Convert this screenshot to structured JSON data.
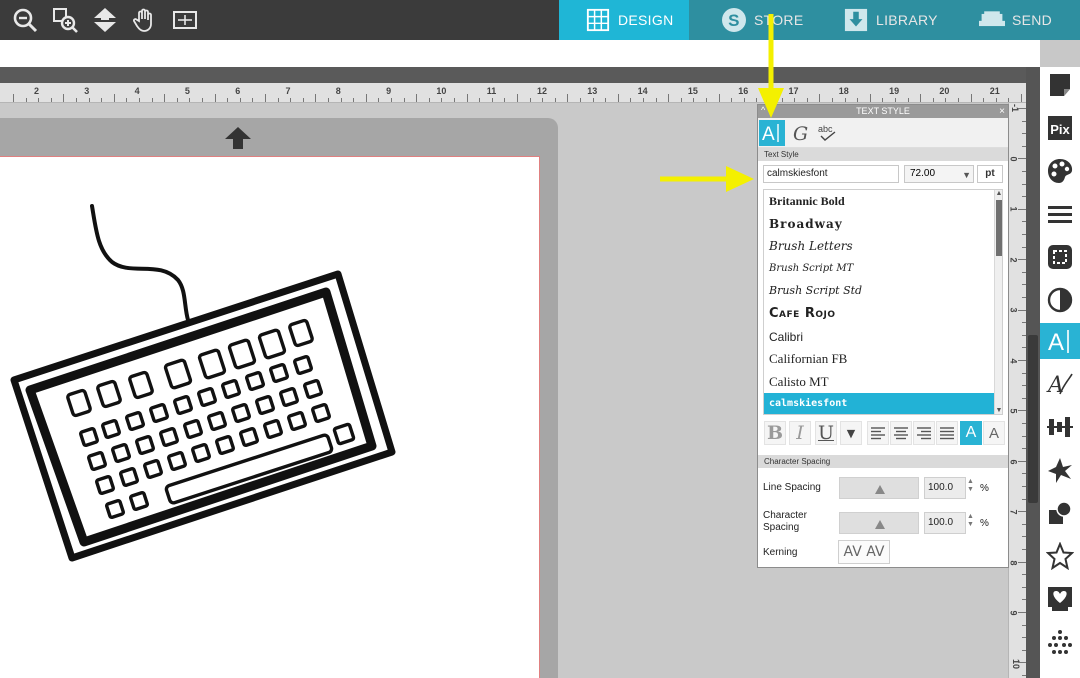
{
  "tabs": {
    "design": "DESIGN",
    "store": "STORE",
    "library": "LIBRARY",
    "send": "SEND"
  },
  "toolbar_icons": [
    "zoom-out-icon",
    "zoom-fit-icon",
    "move-icon",
    "pan-hand-icon",
    "fit-to-page-icon"
  ],
  "ruler": {
    "top_numbers": [
      "2",
      "3",
      "4",
      "5",
      "6",
      "7",
      "8",
      "9",
      "10",
      "11",
      "12",
      "13",
      "14",
      "15",
      "16",
      "17",
      "18",
      "19",
      "20",
      "21"
    ],
    "side_numbers": [
      "-1",
      "0",
      "1",
      "2",
      "3",
      "4",
      "5",
      "6",
      "7",
      "8",
      "9",
      "10"
    ]
  },
  "panel": {
    "title": "TEXT STYLE",
    "close_label": "×",
    "collapse_label": "^",
    "section_text_style": "Text Style",
    "font_name": "calmskiesfont",
    "font_size": "72.00",
    "font_unit": "pt",
    "fonts": [
      {
        "name": "Britannic Bold",
        "selected": false
      },
      {
        "name": "Broadway",
        "selected": false
      },
      {
        "name": "Brush Letters",
        "selected": false
      },
      {
        "name": "Brush Script MT",
        "selected": false
      },
      {
        "name": "Brush Script Std",
        "selected": false
      },
      {
        "name": "Cafe Rojo",
        "selected": false
      },
      {
        "name": "Calibri",
        "selected": false
      },
      {
        "name": "Californian FB",
        "selected": false
      },
      {
        "name": "Calisto MT",
        "selected": false
      },
      {
        "name": "calmskiesfont",
        "selected": true
      }
    ],
    "format_buttons": {
      "bold": "B",
      "italic": "I",
      "underline": "U"
    },
    "section_spacing": "Character Spacing",
    "line_spacing_label": "Line Spacing",
    "line_spacing_value": "100.0",
    "char_spacing_label": "Character Spacing",
    "char_spacing_value": "100.0",
    "percent": "%",
    "kerning_label": "Kerning",
    "kerning_value": "AV AV"
  },
  "sidebar_icons": [
    "page-setup-icon",
    "pixscan-icon",
    "fill-color-icon",
    "line-style-icon",
    "image-trace-icon",
    "transparency-icon",
    "text-style-icon",
    "sketch-icon",
    "align-icon",
    "replicate-icon",
    "modify-icon",
    "offset-icon",
    "star-shape-icon",
    "heart-image-icon",
    "dots-icon"
  ],
  "colors": {
    "accent": "#29b3d4",
    "tab_inactive": "#2e8fa0",
    "arrow": "#f4f000"
  }
}
